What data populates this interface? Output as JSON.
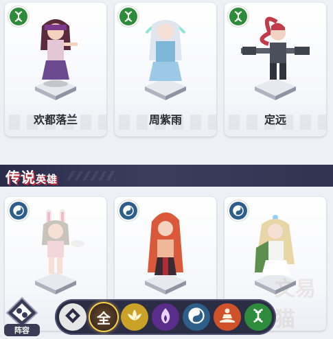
{
  "cards": [
    {
      "name": "欢都落兰",
      "faction_icon": "dna-icon",
      "badge_color": "#2e8b3c"
    },
    {
      "name": "周紫雨",
      "faction_icon": "dna-icon",
      "badge_color": "#2e8b3c"
    },
    {
      "name": "定远",
      "faction_icon": "dna-icon",
      "badge_color": "#2e8b3c"
    },
    {
      "name": "",
      "faction_icon": "yin-yang-icon",
      "badge_color": "#2d5f8a"
    },
    {
      "name": "",
      "faction_icon": "yin-yang-icon",
      "badge_color": "#2d5f8a"
    },
    {
      "name": "",
      "faction_icon": "yin-yang-icon",
      "badge_color": "#2d5f8a"
    }
  ],
  "section": {
    "title_main": "传说",
    "title_sub": "英雄"
  },
  "lineup_button": {
    "label": "阵容",
    "icon": "lineup-icon"
  },
  "filters": [
    {
      "id": "diamond",
      "icon": "diamond-icon",
      "color": "#d9d9d9"
    },
    {
      "id": "all",
      "label": "全",
      "icon": "all-icon",
      "color": "#8a6a2a",
      "selected": true
    },
    {
      "id": "lotus",
      "icon": "lotus-icon",
      "color": "#c9a227"
    },
    {
      "id": "flame",
      "icon": "flame-icon",
      "color": "#5a2d8a"
    },
    {
      "id": "yinyang",
      "icon": "yin-yang-icon",
      "color": "#2d5f8a"
    },
    {
      "id": "meditate",
      "icon": "meditate-icon",
      "color": "#d0522b"
    },
    {
      "id": "dna",
      "icon": "dna-icon",
      "color": "#2e8b3c"
    }
  ],
  "watermark": "文易猫",
  "colors": {
    "accent_red": "#c7293a",
    "bar_dark": "#2a2d49"
  }
}
